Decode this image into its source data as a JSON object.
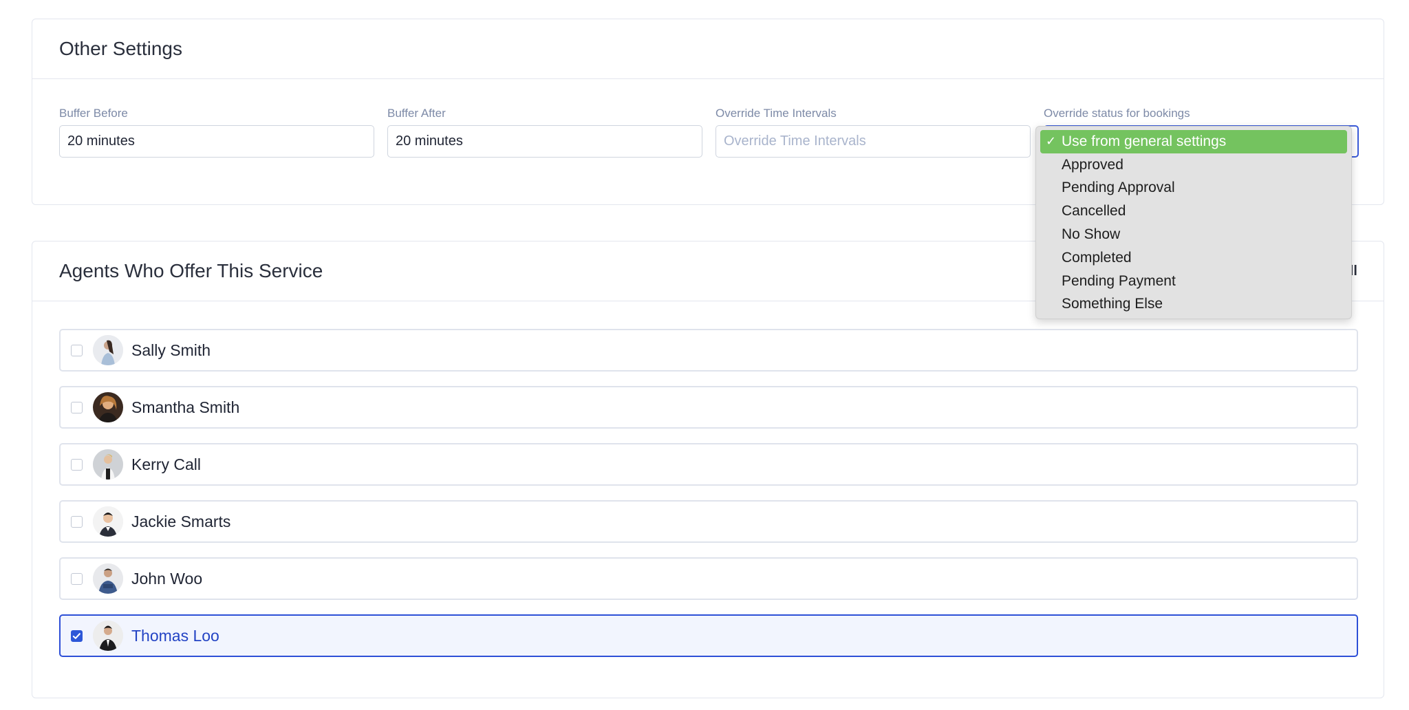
{
  "other_settings": {
    "title": "Other Settings",
    "buffer_before": {
      "label": "Buffer Before",
      "value": "20 minutes"
    },
    "buffer_after": {
      "label": "Buffer After",
      "value": "20 minutes"
    },
    "override_intervals": {
      "label": "Override Time Intervals",
      "placeholder": "Override Time Intervals",
      "value": ""
    },
    "override_status": {
      "label": "Override status for bookings",
      "selected": "Use from general settings",
      "options": [
        "Use from general settings",
        "Approved",
        "Pending Approval",
        "Cancelled",
        "No Show",
        "Completed",
        "Pending Payment",
        "Something Else"
      ]
    }
  },
  "agents_section": {
    "title": "Agents Who Offer This Service",
    "header_action_partial": "ll",
    "agents": [
      {
        "name": "Sally Smith",
        "checked": false
      },
      {
        "name": "Smantha Smith",
        "checked": false
      },
      {
        "name": "Kerry Call",
        "checked": false
      },
      {
        "name": "Jackie Smarts",
        "checked": false
      },
      {
        "name": "John Woo",
        "checked": false
      },
      {
        "name": "Thomas Loo",
        "checked": true
      }
    ]
  },
  "colors": {
    "accent": "#2d57d8",
    "dropdown_highlight": "#74c35f",
    "label": "#7d8aa7"
  }
}
